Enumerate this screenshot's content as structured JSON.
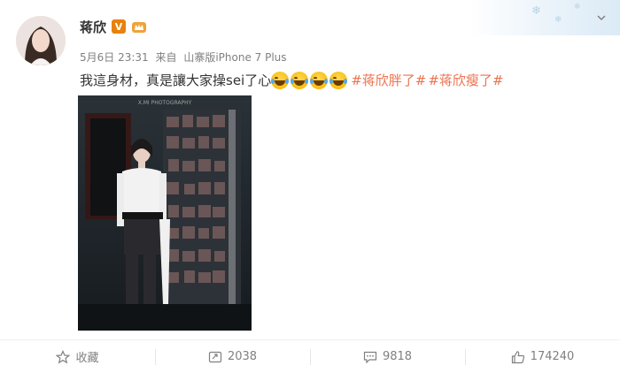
{
  "post": {
    "username": "蒋欣",
    "verified_badge": "V",
    "meta_date": "5月6日 23:31",
    "meta_from": "来自",
    "meta_device": "山寨版iPhone 7 Plus",
    "text": "我這身材，真是讓大家操sei了心",
    "emoji_count": 4,
    "emoji_name": "laugh-cry-emoji",
    "hashtags": [
      "#蒋欣胖了#",
      "#蒋欣瘦了#"
    ],
    "photo_watermark": "X.MI PHOTOGRAPHY"
  },
  "toolbar": {
    "favorite_label": "收藏",
    "repost_count": "2038",
    "comment_count": "9818",
    "like_count": "174240"
  },
  "colors": {
    "hashtag": "#eb7350",
    "verified": "#e8820c",
    "muted": "#808080"
  }
}
